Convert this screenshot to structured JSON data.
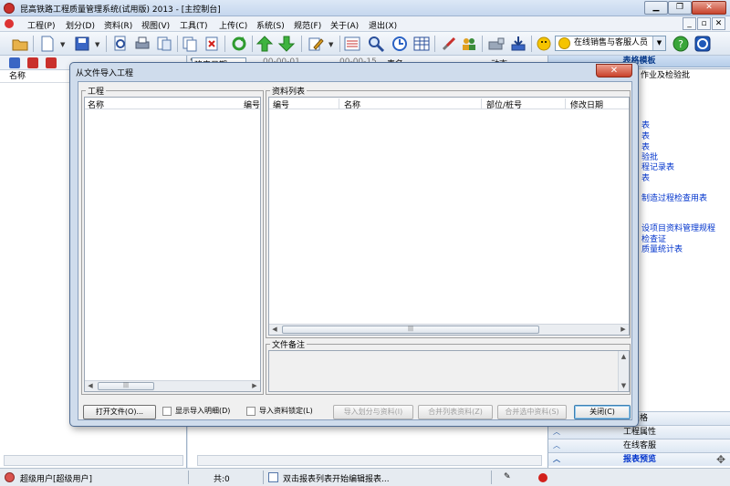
{
  "window": {
    "title": "昆高铁路工程质量管理系统(试用版) 2013 - [主控制台]"
  },
  "menubar": {
    "items": [
      "工程(P)",
      "划分(D)",
      "资料(R)",
      "视图(V)",
      "工具(T)",
      "上传(C)",
      "系统(S)",
      "规范(F)",
      "关于(A)",
      "退出(X)"
    ]
  },
  "toolbar": {
    "online_support": "在线销售与客服人员"
  },
  "left_pane": {
    "column_name": "名称"
  },
  "mid_pane": {
    "date_label": "建表日期",
    "date_from": "00-00-01",
    "date_to": "00-00-15",
    "table_name_label": "表名",
    "action_label": "动态"
  },
  "right_pane": {
    "header": "表格模板",
    "tab_label": "作业及检验批",
    "links": [
      "表",
      "表",
      "表",
      "验批",
      "程记录表",
      "表",
      "制造过程检查用表",
      "设项目资料管理规程",
      "检查证",
      "质量统计表"
    ],
    "bottom_items": [
      "表格",
      "工程属性",
      "在线客服",
      "报表预览"
    ]
  },
  "dialog": {
    "title": "从文件导入工程",
    "close_glyph": "✕",
    "project_group": {
      "label": "工程",
      "columns": [
        "名称",
        "编号"
      ]
    },
    "data_group": {
      "label": "资料列表",
      "columns": [
        "编号",
        "名称",
        "部位/桩号",
        "修改日期"
      ]
    },
    "notes_group": {
      "label": "文件备注"
    },
    "buttons": {
      "open_file": "打开文件(O)...",
      "import_partition": "导入划分与资料(I)",
      "merge_list": "合并列表资料(Z)",
      "merge_selected": "合并选中资料(S)",
      "close": "关闭(C)"
    },
    "checkboxes": {
      "show_detail": "显示导入明细(D)",
      "lock_data": "导入资料锁定(L)"
    }
  },
  "statusbar": {
    "user": "超级用户[超级用户]",
    "count": "共:0",
    "hint": "双击报表列表开始编辑报表..."
  }
}
